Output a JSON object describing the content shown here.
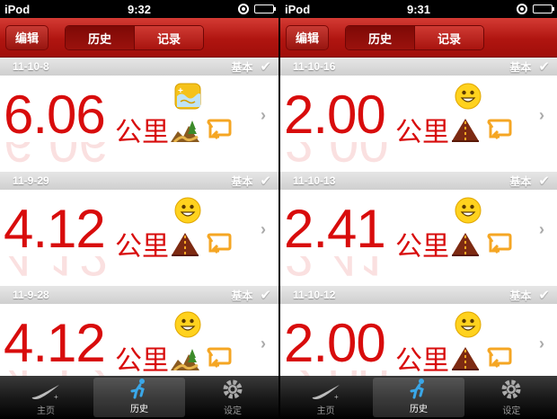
{
  "screens": [
    {
      "status": {
        "carrier": "iPod",
        "time": "9:32"
      },
      "nav": {
        "edit": "编辑",
        "segments": [
          "历史",
          "记录"
        ]
      },
      "runs": [
        {
          "date": "11-10-8",
          "type": "基本",
          "distance": "6.06",
          "unit": "公里",
          "mood": "mood-happy-icon",
          "terrain": "trail-icon"
        },
        {
          "date": "11-9-29",
          "type": "基本",
          "distance": "4.12",
          "unit": "公里",
          "mood": "smiley-icon",
          "terrain": "road-icon"
        },
        {
          "date": "11-9-28",
          "type": "基本",
          "distance": "4.12",
          "unit": "公里",
          "mood": "smiley-icon",
          "terrain": "trail-icon"
        }
      ],
      "tabs": [
        "主页",
        "历史",
        "设定"
      ]
    },
    {
      "status": {
        "carrier": "iPod",
        "time": "9:31"
      },
      "nav": {
        "edit": "编辑",
        "segments": [
          "历史",
          "记录"
        ]
      },
      "runs": [
        {
          "date": "11-10-16",
          "type": "基本",
          "distance": "2.00",
          "unit": "公里",
          "mood": "smiley-icon",
          "terrain": "road-icon"
        },
        {
          "date": "11-10-13",
          "type": "基本",
          "distance": "2.41",
          "unit": "公里",
          "mood": "smiley-icon",
          "terrain": "road-icon"
        },
        {
          "date": "11-10-12",
          "type": "基本",
          "distance": "2.00",
          "unit": "公里",
          "mood": "smiley-icon",
          "terrain": "road-icon"
        }
      ],
      "tabs": [
        "主页",
        "历史",
        "设定"
      ]
    }
  ],
  "colors": {
    "accent": "#d80c0c",
    "nav": "#b01510"
  }
}
